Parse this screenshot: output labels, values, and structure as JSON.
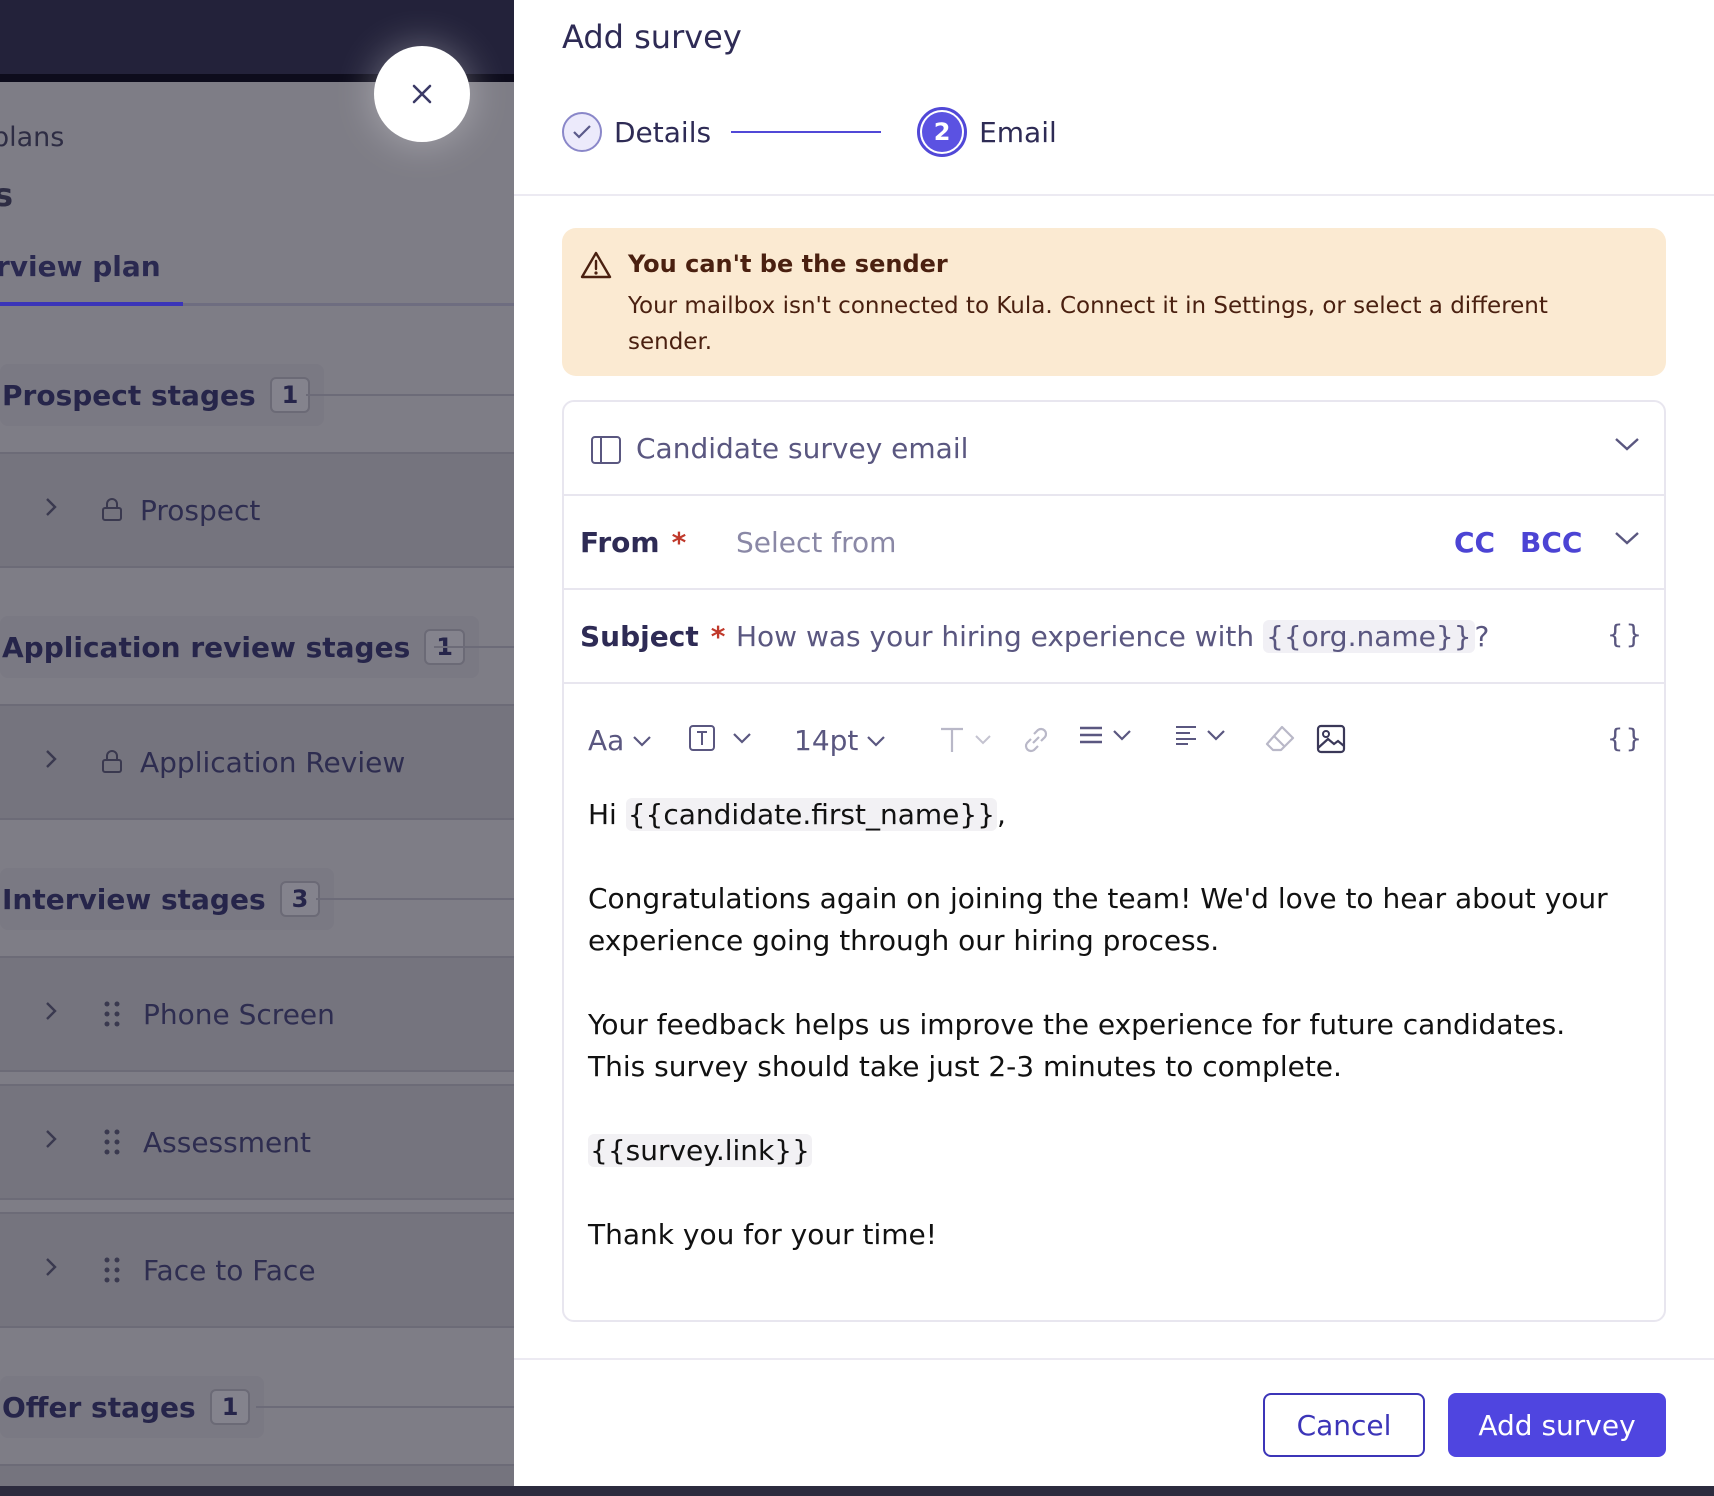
{
  "background": {
    "breadcrumb": "plans",
    "title_fragment": "s",
    "active_tab": "rview plan",
    "groups": [
      {
        "name": "Prospect stages",
        "count": "1",
        "stages": [
          "Prospect"
        ]
      },
      {
        "name": "Application review stages",
        "count": "1",
        "stages": [
          "Application Review"
        ]
      },
      {
        "name": "Interview stages",
        "count": "3",
        "stages": [
          "Phone Screen",
          "Assessment",
          "Face to Face"
        ]
      },
      {
        "name": "Offer stages",
        "count": "1",
        "stages": []
      }
    ]
  },
  "drawer": {
    "title": "Add survey",
    "steps": [
      {
        "label": "Details",
        "state": "done"
      },
      {
        "number": "2",
        "label": "Email",
        "state": "active"
      }
    ],
    "alert": {
      "title": "You can't be the sender",
      "message": "Your mailbox isn't connected to Kula. Connect it in Settings, or select a different sender."
    },
    "template_name": "Candidate survey email",
    "from": {
      "label": "From",
      "required_mark": "*",
      "placeholder": "Select from",
      "cc": "CC",
      "bcc": "BCC"
    },
    "subject": {
      "label": "Subject",
      "required_mark": "*",
      "text_before": "How was your hiring experience with ",
      "variable": "{{org.name}}",
      "text_after": "?"
    },
    "toolbar": {
      "font": "Aa",
      "font_size": "14pt"
    },
    "body": {
      "greeting_prefix": "Hi ",
      "greeting_var": "{{candidate.first_name}}",
      "greeting_suffix": ",",
      "para1": "Congratulations again on joining the team! We'd love to hear about your experience going through our hiring process.",
      "para2": "Your feedback helps us improve the experience for future candidates. This survey should take just 2-3 minutes to complete.",
      "link_var": "{{survey.link}}",
      "closing": "Thank you for your time!"
    },
    "buttons": {
      "cancel": "Cancel",
      "submit": "Add survey"
    }
  },
  "colors": {
    "accent": "#4f45e0",
    "warning_bg": "#fbead2",
    "warning_text": "#4a2010"
  }
}
